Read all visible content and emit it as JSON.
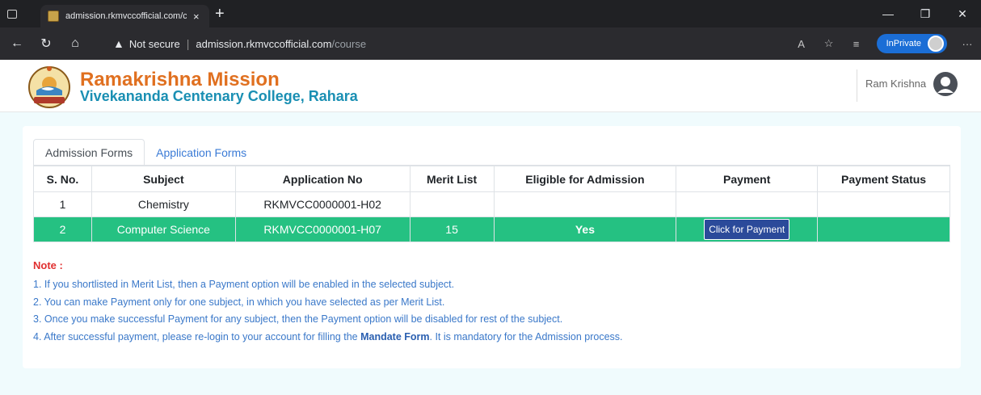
{
  "browser": {
    "tab_title": "admission.rkmvccofficial.com/co",
    "tab_close": "×",
    "new_tab": "+",
    "not_secure": "Not secure",
    "url_host": "admission.rkmvccofficial.com",
    "url_path": "/course",
    "inprivate": "InPrivate",
    "icons": [
      "back-icon",
      "refresh-icon",
      "home-icon",
      "warning-icon",
      "read-aloud-icon",
      "favorites-add-icon",
      "favorites-icon",
      "more-icon",
      "minimize-icon",
      "restore-icon",
      "close-icon"
    ]
  },
  "header": {
    "brand_line1": "Ramakrishna Mission",
    "brand_line2": "Vivekananda Centenary College, Rahara",
    "user_name": "Ram Krishna"
  },
  "tabs": {
    "admission": "Admission Forms",
    "application": "Application Forms"
  },
  "table": {
    "headers": [
      "S. No.",
      "Subject",
      "Application No",
      "Merit List",
      "Eligible for Admission",
      "Payment",
      "Payment Status"
    ],
    "rows": [
      {
        "sno": "1",
        "subject": "Chemistry",
        "app_no": "RKMVCC0000001-H02",
        "merit": "",
        "eligible": "",
        "payment": "",
        "status": ""
      },
      {
        "sno": "2",
        "subject": "Computer Science",
        "app_no": "RKMVCC0000001-H07",
        "merit": "15",
        "eligible": "Yes",
        "payment": "Click for Payment",
        "status": ""
      }
    ]
  },
  "notes": {
    "title": "Note :",
    "n1": "1. If you shortlisted in Merit List, then a Payment option will be enabled in the selected subject.",
    "n2": "2. You can make Payment only for one subject, in which you have selected as per Merit List.",
    "n3": "3. Once you make successful Payment for any subject, then the Payment option will be disabled for rest of the subject.",
    "n4_pre": "4. After successful payment, please re-login to your account for filling the ",
    "n4_bold": "Mandate Form",
    "n4_post": ". It is mandatory for the Admission process."
  },
  "colors": {
    "highlight_row": "#25c182",
    "brand_orange": "#e07020",
    "brand_blue": "#1a8fb3",
    "payment_button": "#2b4a9a",
    "note_text": "#3a78c9",
    "note_title": "#e03030"
  }
}
